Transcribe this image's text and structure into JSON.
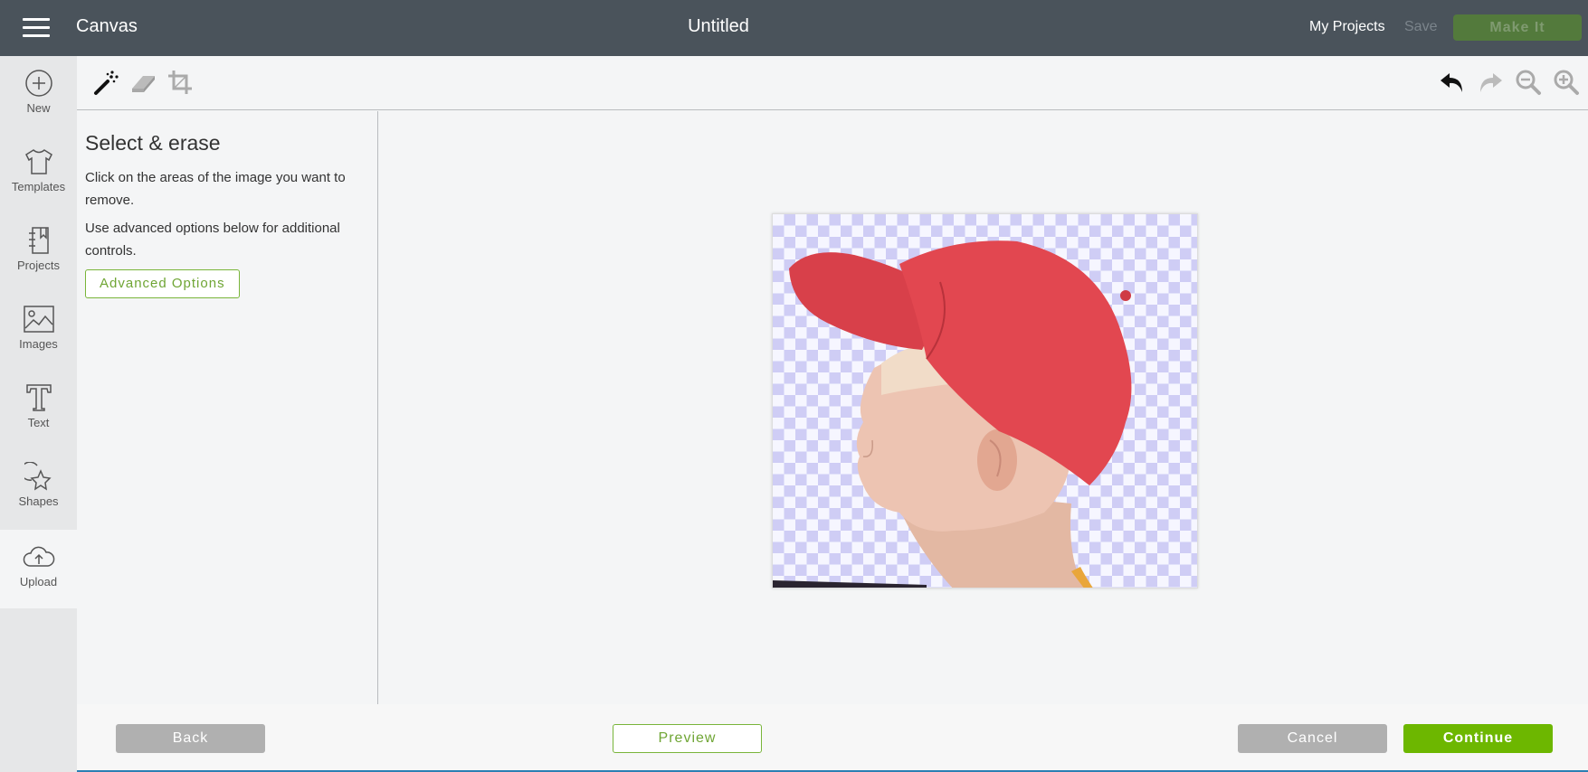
{
  "header": {
    "app_name": "Canvas",
    "document_title": "Untitled",
    "my_projects_label": "My Projects",
    "save_label": "Save",
    "make_it_label": "Make It"
  },
  "sidebar": {
    "items": [
      {
        "label": "New",
        "icon": "plus-circle-icon"
      },
      {
        "label": "Templates",
        "icon": "shirt-icon"
      },
      {
        "label": "Projects",
        "icon": "notebook-icon"
      },
      {
        "label": "Images",
        "icon": "image-icon"
      },
      {
        "label": "Text",
        "icon": "text-t-icon"
      },
      {
        "label": "Shapes",
        "icon": "shapes-icon"
      },
      {
        "label": "Upload",
        "icon": "cloud-upload-icon",
        "active": true
      }
    ]
  },
  "toolbar": {
    "left_tools": [
      "magic-wand-icon",
      "eraser-icon",
      "crop-icon"
    ],
    "right_tools": [
      "undo-icon",
      "redo-icon",
      "zoom-out-icon",
      "zoom-in-icon"
    ]
  },
  "panel": {
    "title": "Select & erase",
    "instruction_1": "Click on the areas of the image you want to remove.",
    "instruction_2": "Use advanced options below for additional controls.",
    "advanced_button": "Advanced Options"
  },
  "canvas": {
    "image_description": "Boy in red baseball cap, profile view, background partially erased (transparent checkerboard)"
  },
  "footer": {
    "back_label": "Back",
    "preview_label": "Preview",
    "cancel_label": "Cancel",
    "continue_label": "Continue"
  },
  "colors": {
    "header_bg": "#4a535b",
    "accent_green": "#6db700",
    "checker_color": "#cfcdf5"
  }
}
